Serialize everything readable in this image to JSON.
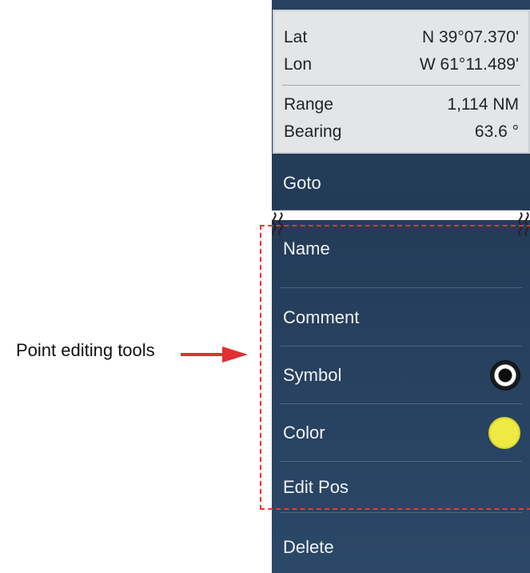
{
  "info": {
    "lat_label": "Lat",
    "lat_value": "N 39°07.370'",
    "lon_label": "Lon",
    "lon_value": "W 61°11.489'",
    "range_label": "Range",
    "range_value": "1,114 NM",
    "bearing_label": "Bearing",
    "bearing_value": "63.6 °"
  },
  "menu": {
    "goto": "Goto",
    "name": "Name",
    "comment": "Comment",
    "symbol": "Symbol",
    "color": "Color",
    "edit_pos": "Edit Pos",
    "delete": "Delete"
  },
  "annotation": {
    "label": "Point editing tools"
  },
  "colors": {
    "panel_bg": "#243b57",
    "info_bg": "#e3e5e7",
    "annotation": "#ff3030",
    "selected_color": "#eeea42"
  },
  "icons": {
    "symbol": "filled-ring-icon",
    "color": "yellow-circle-icon",
    "break": "wavy-break-icon"
  }
}
